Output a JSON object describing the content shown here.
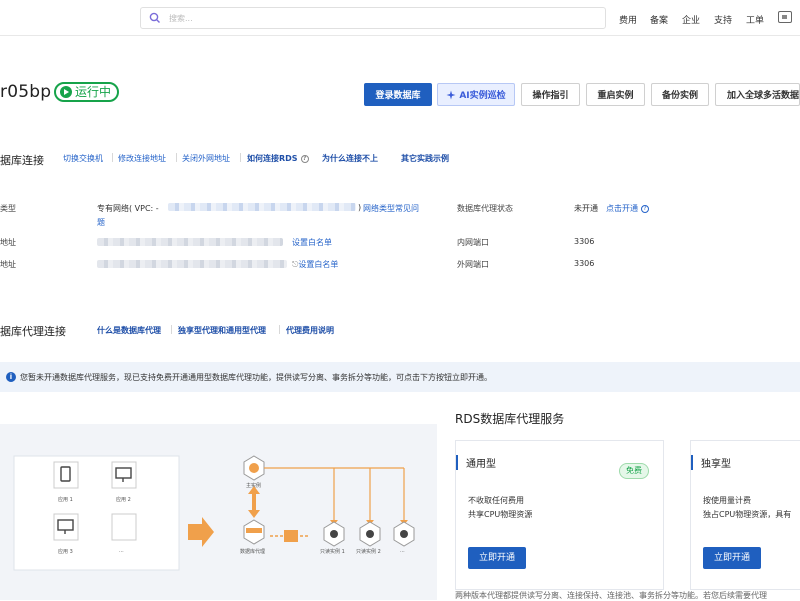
{
  "topbar": {
    "search_placeholder": "搜索...",
    "nav": [
      "费用",
      "备案",
      "企业",
      "支持",
      "工单"
    ]
  },
  "instance": {
    "name": "r05bp",
    "status": "运行中"
  },
  "actions": {
    "login_db": "登录数据库",
    "ai_inspect": "AI实例巡检",
    "guide": "操作指引",
    "restart": "重启实例",
    "backup": "备份实例",
    "global": "加入全球多活数据库"
  },
  "conn": {
    "title": "据库连接",
    "links": [
      "切换交换机",
      "修改连接地址",
      "关闭外网地址"
    ],
    "how_connect": "如何连接RDS",
    "why_fail": "为什么连接不上",
    "other_examples": "其它实践示例",
    "rows": {
      "type_label": "类型",
      "type_value": "专有网络( VPC: -",
      "type_paren": ")",
      "type_link": "网络类型常见问",
      "type_link_wrap": "题",
      "addr1_label": "地址",
      "addr1_link": "设置白名单",
      "addr2_label": "地址",
      "addr2_link": "设置白名单",
      "proxy_status_label": "数据库代理状态",
      "proxy_status_value": "未开通",
      "proxy_open_link": "点击开通",
      "inner_port_label": "内网端口",
      "inner_port_value": "3306",
      "outer_port_label": "外网端口",
      "outer_port_value": "3306"
    }
  },
  "proxy": {
    "title": "据库代理连接",
    "links": [
      "什么是数据库代理",
      "独享型代理和通用型代理",
      "代理费用说明"
    ]
  },
  "notice": {
    "text": "您暂未开通数据库代理服务，现已支持免费开通通用型数据库代理功能，提供读写分离、事务拆分等功能，可点击下方按钮立即开通。"
  },
  "diagram": {
    "apps": [
      "应用 1",
      "应用 2",
      "应用 3",
      "..."
    ],
    "master": "主实例",
    "proxy": "数据库代理",
    "readonly": [
      "只读实例 1",
      "只读实例 2",
      "..."
    ]
  },
  "service": {
    "title": "RDS数据库代理服务",
    "cards": [
      {
        "title": "通用型",
        "badge": "免费",
        "line1": "不收取任何费用",
        "line2": "共享CPU物理资源",
        "button": "立即开通"
      },
      {
        "title": "独享型",
        "line1": "按使用量计费",
        "line2": "独占CPU物理资源，具有",
        "button": "立即开通"
      }
    ],
    "footnote": "两种版本代理都提供读写分离、连接保持、连接池、事务拆分等功能。若您后续需要代理"
  },
  "colors": {
    "primary": "#1f5fbf",
    "link": "#2563c9",
    "status": "#16a34a",
    "notice_bg": "#eef3fa"
  }
}
